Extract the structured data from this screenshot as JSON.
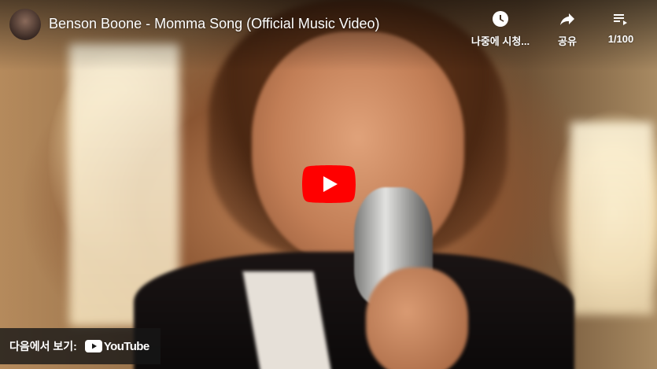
{
  "video": {
    "title": "Benson Boone - Momma Song (Official Music Video)",
    "channel_avatar": "channel-avatar"
  },
  "actions": {
    "watch_later": {
      "label": "나중에 시청...",
      "icon": "clock-icon"
    },
    "share": {
      "label": "공유",
      "icon": "share-arrow-icon"
    },
    "playlist": {
      "label": "1/100",
      "icon": "playlist-icon"
    }
  },
  "play_button": {
    "icon": "play-icon",
    "color": "#ff0000"
  },
  "watch_on": {
    "label": "다음에서 보기:",
    "brand": "YouTube"
  }
}
